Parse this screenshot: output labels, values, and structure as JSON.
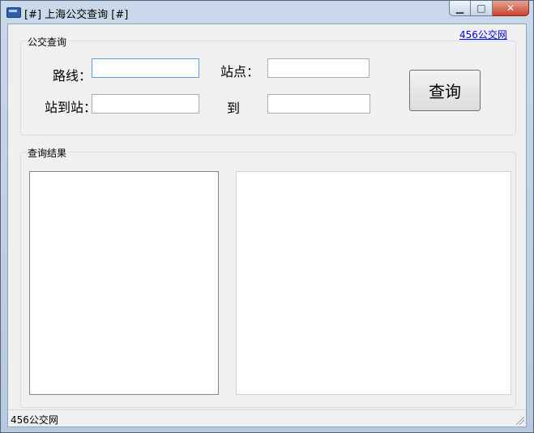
{
  "window": {
    "title": "[#] 上海公交查询 [#]"
  },
  "header_link": "456公交网",
  "search_group": {
    "title": "公交查询",
    "route_label": "路线：",
    "stop_label": "站点：",
    "station_label": "站到站：",
    "to_label": "到",
    "query_button": "查询"
  },
  "results_group": {
    "title": "查询结果"
  },
  "status_bar": {
    "text": "456公交网"
  }
}
